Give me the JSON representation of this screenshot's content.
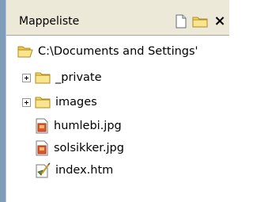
{
  "panel": {
    "title": "Mappeliste",
    "buttons": {
      "new_file": "new-document-icon",
      "new_folder": "new-folder-icon",
      "close": "×"
    }
  },
  "tree": {
    "root": {
      "label": "C:\\Documents and Settings'",
      "icon": "folder-open-icon"
    },
    "items": [
      {
        "label": "_private",
        "icon": "folder-icon",
        "expandable": true
      },
      {
        "label": "images",
        "icon": "folder-icon",
        "expandable": true
      },
      {
        "label": "humlebi.jpg",
        "icon": "image-file-icon",
        "expandable": false
      },
      {
        "label": "solsikker.jpg",
        "icon": "image-file-icon",
        "expandable": false
      },
      {
        "label": "index.htm",
        "icon": "html-file-icon",
        "expandable": false
      }
    ]
  },
  "colors": {
    "header_bg": "#ece9d8",
    "frame": "#7f9db9",
    "folder": "#f6d86b"
  }
}
